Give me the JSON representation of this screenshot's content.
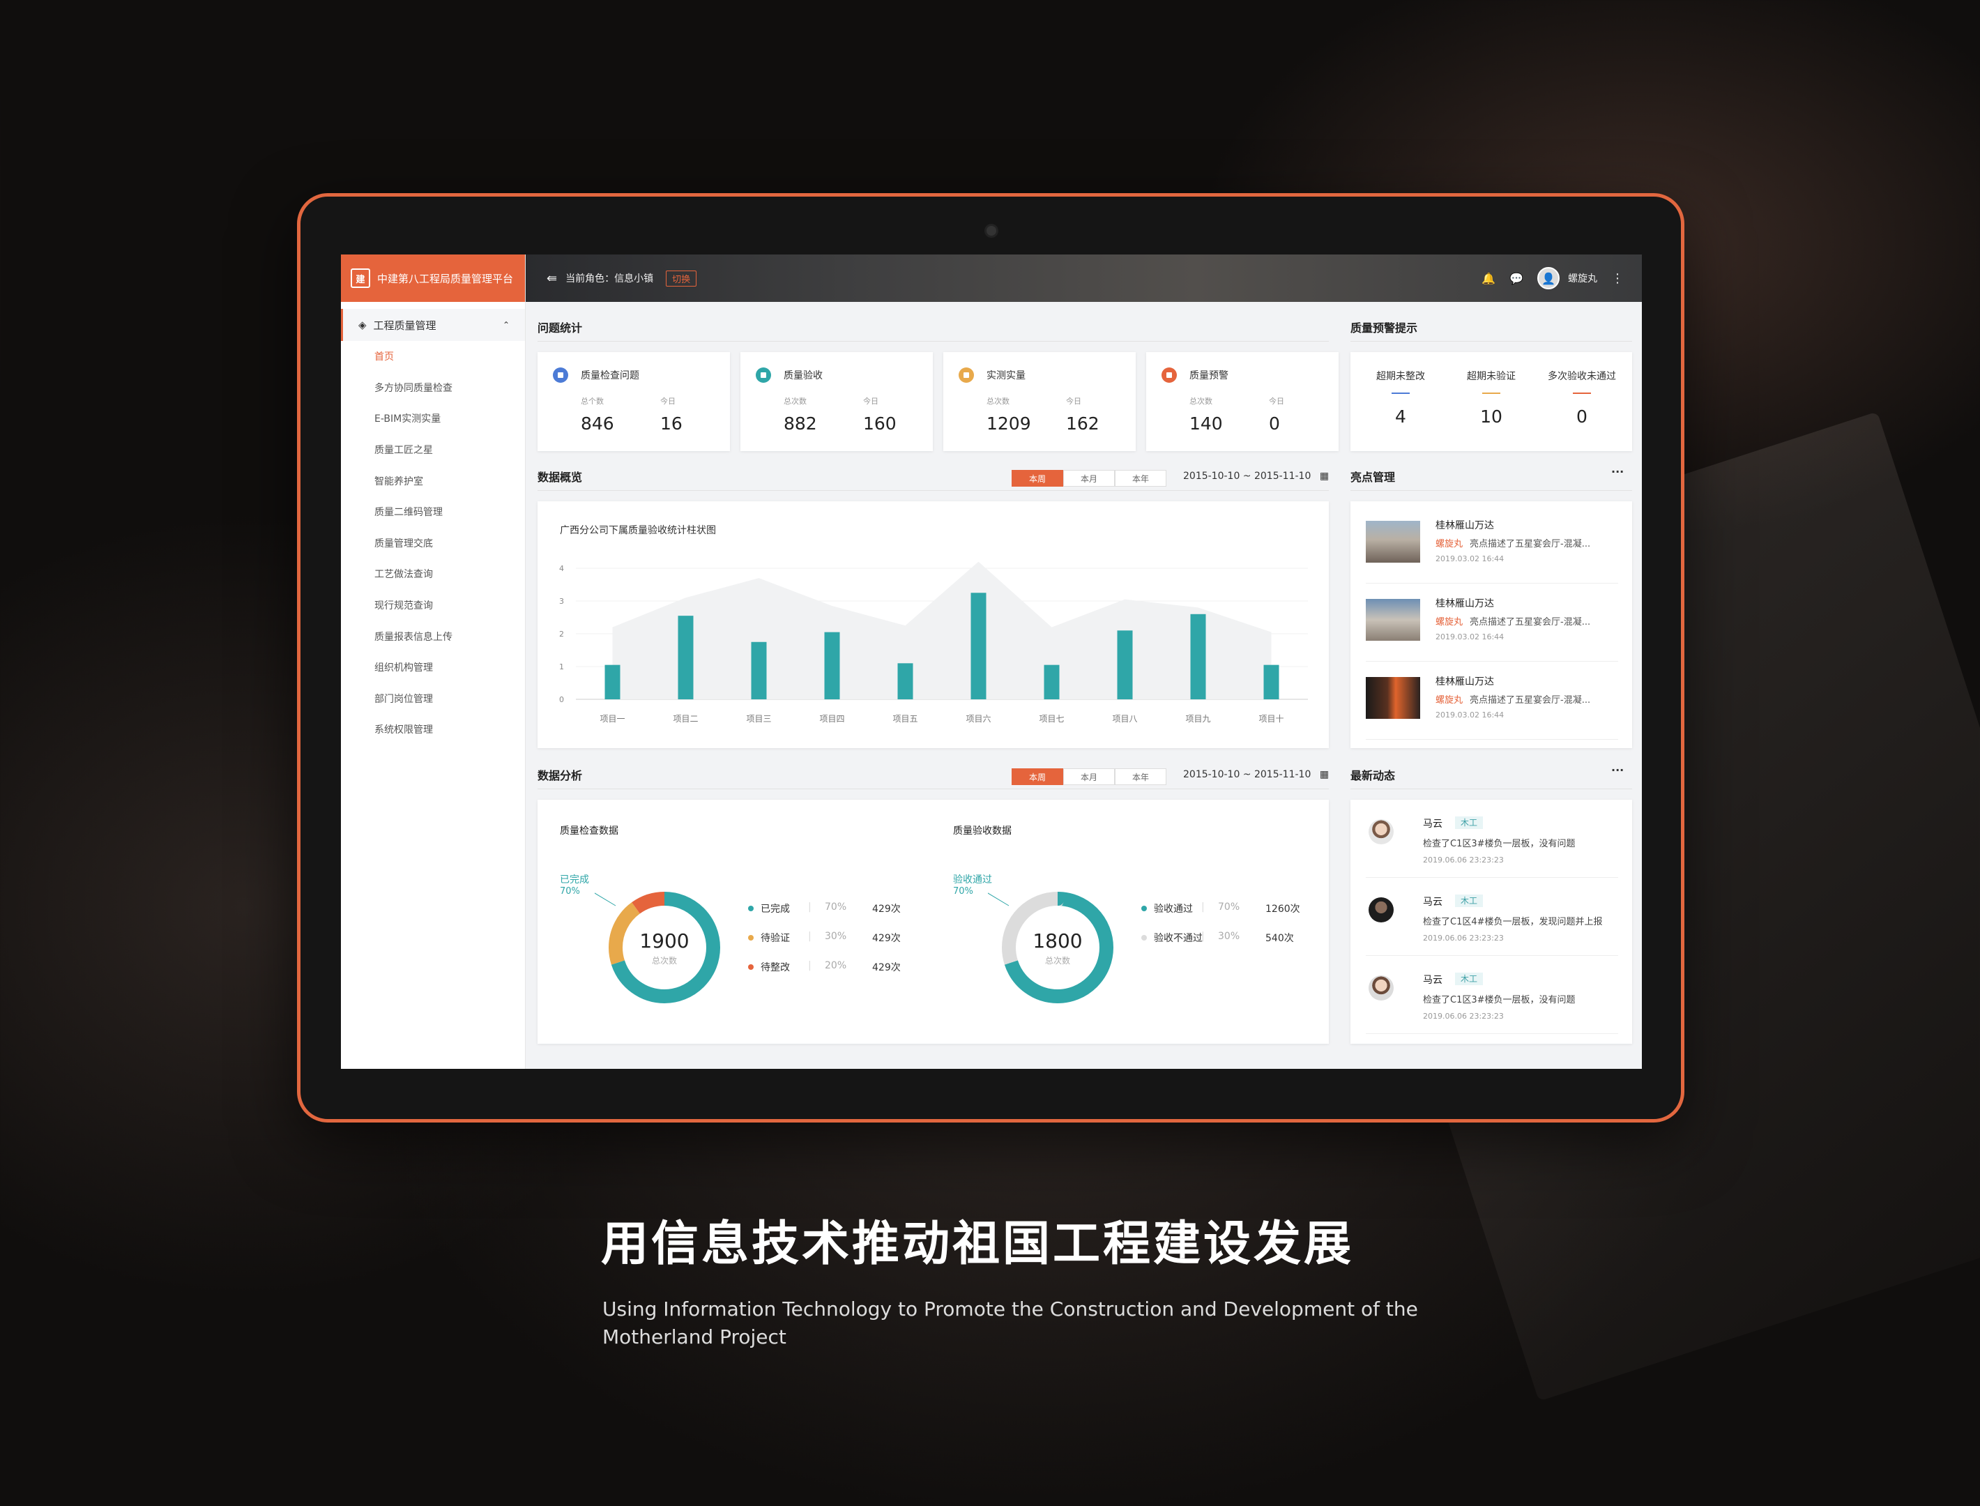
{
  "sidebar": {
    "brand": "中建第八工程局质量管理平台",
    "brand_icon": "建",
    "group": "工程质量管理",
    "items": [
      "首页",
      "多方协同质量检查",
      "E-BIM实测实量",
      "质量工匠之星",
      "智能养护室",
      "质量二维码管理",
      "质量管理交底",
      "工艺做法查询",
      "现行规范查询",
      "质量报表信息上传",
      "组织机构管理",
      "部门岗位管理",
      "系统权限管理"
    ]
  },
  "topbar": {
    "role": "当前角色：信息小镇",
    "switch": "切换",
    "user": "螺旋丸",
    "avatar": "👤",
    "bell": "🔔",
    "chat": "💬",
    "more": "⋮",
    "toggle": "⇚"
  },
  "sections": {
    "issues": "问题统计",
    "warning": "质量预警提示",
    "overview": "数据概览",
    "highlights": "亮点管理",
    "analysis": "数据分析",
    "activity": "最新动态"
  },
  "stats": [
    {
      "title": "质量检查问题",
      "l1": "总个数",
      "l2": "今日",
      "v1": "846",
      "v2": "16",
      "color": "#4c7bd6"
    },
    {
      "title": "质量验收",
      "l1": "总次数",
      "l2": "今日",
      "v1": "882",
      "v2": "160",
      "color": "#2fa6a8"
    },
    {
      "title": "实测实量",
      "l1": "总次数",
      "l2": "今日",
      "v1": "1209",
      "v2": "162",
      "color": "#e8a94b"
    },
    {
      "title": "质量预警",
      "l1": "总次数",
      "l2": "今日",
      "v1": "140",
      "v2": "0",
      "color": "#e5643c"
    }
  ],
  "warnings": [
    {
      "t": "超期未整改",
      "v": "4",
      "color": "#4c7bd6"
    },
    {
      "t": "超期未验证",
      "v": "10",
      "color": "#e8a94b"
    },
    {
      "t": "多次验收未通过",
      "v": "0",
      "color": "#e5643c"
    }
  ],
  "tabs": [
    "本周",
    "本月",
    "本年"
  ],
  "daterange": "2015-10-10 ~ 2015-11-10",
  "more": "···",
  "chart_data": {
    "type": "bar",
    "title": "广西分公司下属质量验收统计柱状图",
    "categories": [
      "项目一",
      "项目二",
      "项目三",
      "项目四",
      "项目五",
      "项目六",
      "项目七",
      "项目八",
      "项目九",
      "项目十"
    ],
    "values": [
      1.05,
      2.55,
      1.75,
      2.05,
      1.1,
      3.25,
      1.05,
      2.1,
      2.6,
      1.05
    ],
    "background_area": [
      2.2,
      3.1,
      3.7,
      2.85,
      2.25,
      4.2,
      2.2,
      3.05,
      2.8,
      2.05
    ],
    "yticks": [
      "0",
      "1",
      "2",
      "3",
      "4"
    ],
    "ylim": [
      0,
      4
    ],
    "bar_color": "#2fa6a8"
  },
  "highlights": [
    {
      "t1": "桂林雁山万达",
      "who": "螺旋丸",
      "desc": "亮点描述了五星宴会厅-混凝...",
      "time": "2019.03.02  16:44"
    },
    {
      "t1": "桂林雁山万达",
      "who": "螺旋丸",
      "desc": "亮点描述了五星宴会厅-混凝...",
      "time": "2019.03.02  16:44"
    },
    {
      "t1": "桂林雁山万达",
      "who": "螺旋丸",
      "desc": "亮点描述了五星宴会厅-混凝...",
      "time": "2019.03.02  16:44"
    }
  ],
  "donut1": {
    "title": "质量检查数据",
    "callout": "已完成",
    "callout_pct": "70%",
    "total": "1900",
    "total_label": "总次数",
    "items": [
      {
        "name": "已完成",
        "pct": "70%",
        "count": "429次",
        "value": 0.7,
        "color": "#2fa6a8"
      },
      {
        "name": "待验证",
        "pct": "30%",
        "count": "429次",
        "value": 0.2,
        "color": "#e8a94b"
      },
      {
        "name": "待整改",
        "pct": "20%",
        "count": "429次",
        "value": 0.1,
        "color": "#e5643c"
      }
    ]
  },
  "donut2": {
    "title": "质量验收数据",
    "callout": "验收通过",
    "callout_pct": "70%",
    "total": "1800",
    "total_label": "总次数",
    "items": [
      {
        "name": "验收通过",
        "pct": "70%",
        "count": "1260次",
        "value": 0.7,
        "color": "#2fa6a8"
      },
      {
        "name": "验收不通过",
        "pct": "30%",
        "count": "540次",
        "value": 0.3,
        "color": "#dcdcdc"
      }
    ]
  },
  "activity": [
    {
      "n": "马云",
      "tag": "木工",
      "c": "检查了C1区3#楼负一层板，没有问题",
      "tm": "2019.06.06  23:23:23"
    },
    {
      "n": "马云",
      "tag": "木工",
      "c": "检查了C1区4#楼负一层板，发现问题并上报",
      "tm": "2019.06.06  23:23:23"
    },
    {
      "n": "马云",
      "tag": "木工",
      "c": "检查了C1区3#楼负一层板，没有问题",
      "tm": "2019.06.06  23:23:23"
    }
  ],
  "headline": "用信息技术推动祖国工程建设发展",
  "subline": "Using Information Technology to Promote the Construction and Development of the Motherland Project"
}
